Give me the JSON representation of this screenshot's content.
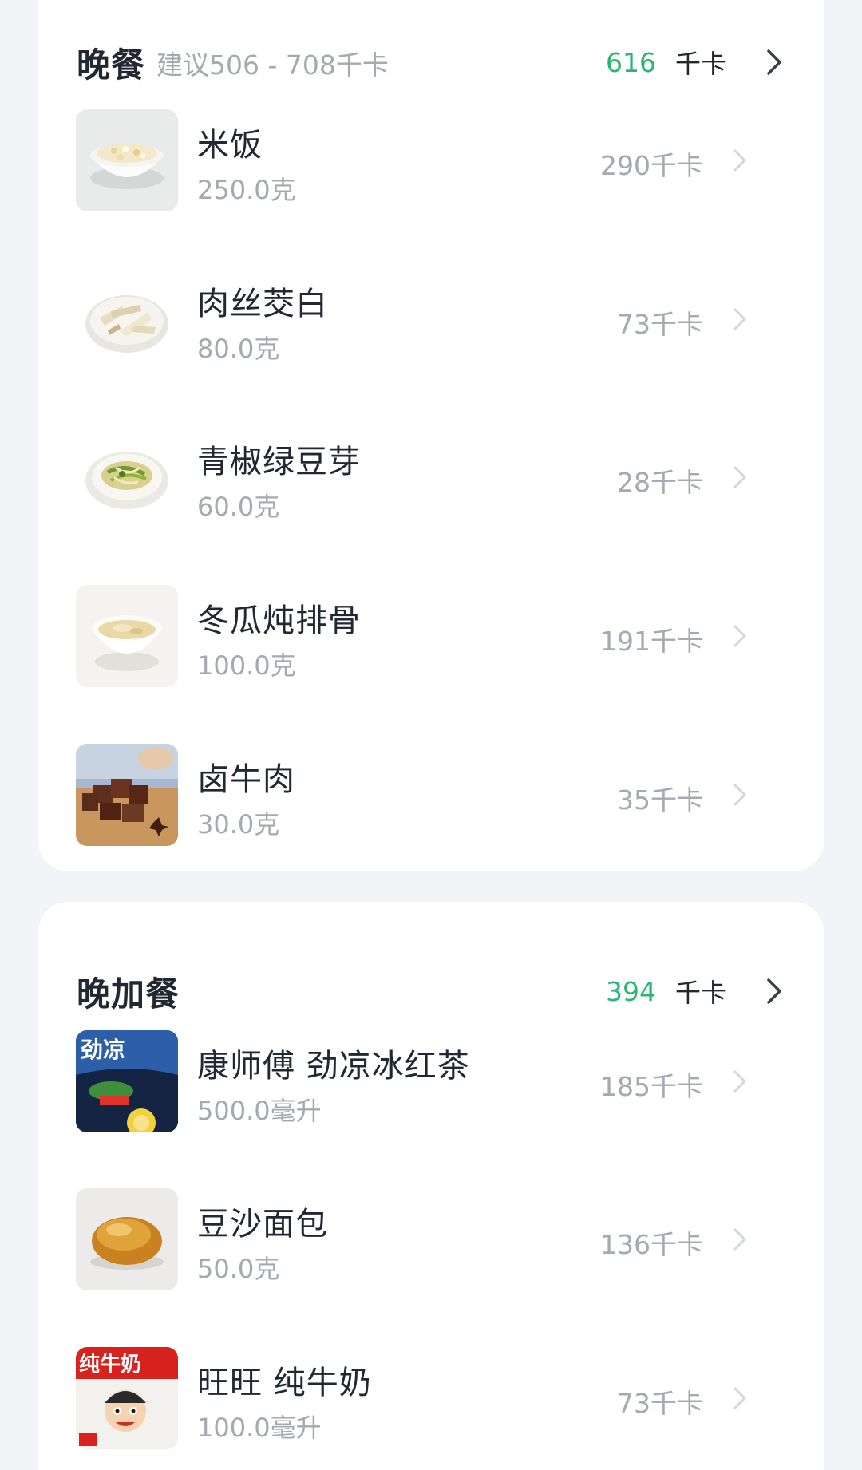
{
  "dinner": {
    "title": "晚餐",
    "suggestion": "建议506 - 708千卡",
    "total": "616",
    "unit": "千卡",
    "items": [
      {
        "name": "米饭",
        "amount": "250.0克",
        "kcal": "290千卡",
        "image": "rice-bowl"
      },
      {
        "name": "肉丝茭白",
        "amount": "80.0克",
        "kcal": "73千卡",
        "image": "stir-fried-pork-water-bamboo"
      },
      {
        "name": "青椒绿豆芽",
        "amount": "60.0克",
        "kcal": "28千卡",
        "image": "green-pepper-bean-sprouts"
      },
      {
        "name": "冬瓜炖排骨",
        "amount": "100.0克",
        "kcal": "191千卡",
        "image": "winter-melon-rib-soup"
      },
      {
        "name": "卤牛肉",
        "amount": "30.0克",
        "kcal": "35千卡",
        "image": "braised-beef"
      }
    ]
  },
  "late_snack": {
    "title": "晚加餐",
    "total": "394",
    "unit": "千卡",
    "items": [
      {
        "name": "康师傅 劲凉冰红茶",
        "amount": "500.0毫升",
        "kcal": "185千卡",
        "image": "iced-tea-bottle"
      },
      {
        "name": "豆沙面包",
        "amount": "50.0克",
        "kcal": "136千卡",
        "image": "red-bean-bun"
      },
      {
        "name": "旺旺 纯牛奶",
        "amount": "100.0毫升",
        "kcal": "73千卡",
        "image": "milk-carton"
      }
    ]
  },
  "colors": {
    "accent_green": "#2bb573",
    "secondary_text": "#a5a9b0",
    "primary_text": "#222831",
    "page_bg": "#f2f4f8"
  },
  "icons": {
    "row_chevron": "chevron-right-icon"
  },
  "thumb_text": {
    "tea_brand": "劲凉",
    "milk_brand": "纯牛奶"
  }
}
